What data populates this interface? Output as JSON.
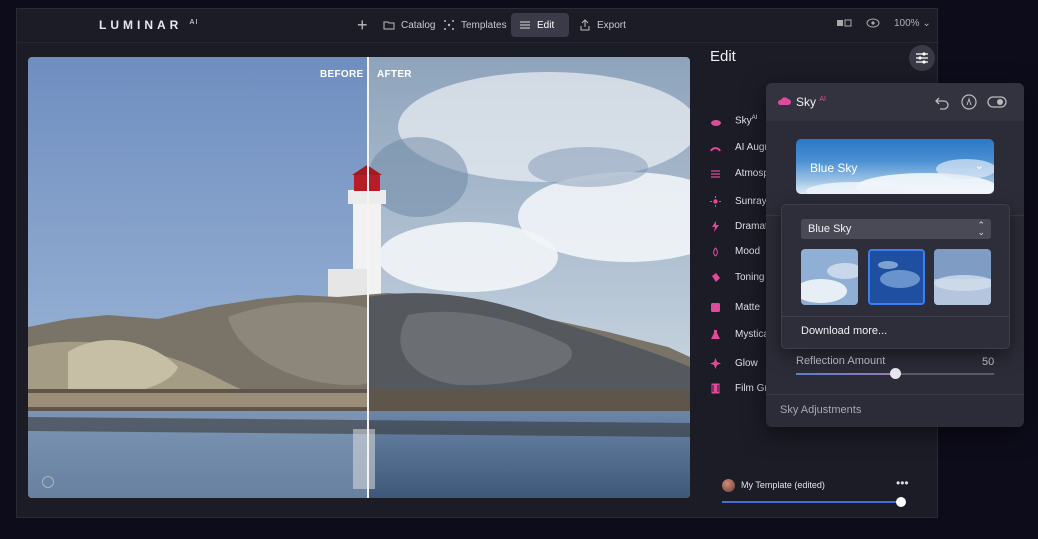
{
  "app": {
    "logo": "LUMINAR",
    "logo_sup": "AI"
  },
  "topbar": {
    "add_label": "+",
    "catalog_label": "Catalog",
    "templates_label": "Templates",
    "edit_label": "Edit",
    "export_label": "Export",
    "zoom_label": "100%"
  },
  "photo": {
    "before_label": "BEFORE",
    "after_label": "AFTER",
    "split_position": 0.514
  },
  "panel": {
    "title": "Edit",
    "tools": [
      {
        "label": "Sky",
        "sup": "AI",
        "icon": "cloud-icon",
        "color": "#e04a9c"
      },
      {
        "label": "AI Augmented Sky",
        "icon": "rainbow-icon",
        "color": "#e04a9c"
      },
      {
        "label": "Atmosphere",
        "icon": "waves-icon",
        "color": "#e04a9c"
      },
      {
        "label": "Sunrays",
        "icon": "sun-icon",
        "color": "#e04a9c"
      },
      {
        "label": "Dramatic",
        "icon": "lightning-icon",
        "color": "#e04a9c"
      },
      {
        "label": "Mood",
        "icon": "lotus-icon",
        "color": "#e04a9c"
      },
      {
        "label": "Toning",
        "icon": "bucket-icon",
        "color": "#e04a9c"
      },
      {
        "label": "Matte",
        "icon": "square-icon",
        "color": "#e04a9c"
      },
      {
        "label": "Mystical",
        "icon": "flask-icon",
        "color": "#e04a9c"
      },
      {
        "label": "Glow",
        "icon": "sparkle-icon",
        "color": "#e04a9c"
      },
      {
        "label": "Film Grain",
        "icon": "film-icon",
        "color": "#e04a9c"
      }
    ],
    "template_name": "My Template (edited)",
    "template_more": "•••"
  },
  "sky_panel": {
    "title": "Sky",
    "title_sup": "AI",
    "preview_name": "Blue Sky",
    "dropdown": {
      "selected": "Blue Sky",
      "thumbnails": [
        "cloudy-sky",
        "deep-blue-sky",
        "hazy-sky"
      ],
      "selected_thumbnail": 1,
      "download_label": "Download more..."
    },
    "reflection_label": "Reflection Amount",
    "reflection_value": "50",
    "reflection_fraction": 0.5,
    "adjustments_label": "Sky Adjustments"
  },
  "colors": {
    "accent": "#e04a9c",
    "selection": "#3e7ef0",
    "background": "#1c1c27"
  }
}
